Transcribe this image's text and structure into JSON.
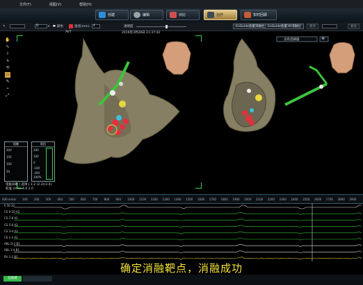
{
  "menu": [
    "文件(F)",
    "视图(V)",
    "帮助(H)"
  ],
  "modes": [
    {
      "label": "创建",
      "color": "#2f8fd8"
    },
    {
      "label": "编辑",
      "color": "#9aa2a8"
    },
    {
      "label": "对比",
      "color": "#d05050"
    },
    {
      "label": "治疗",
      "color": "#d8a850",
      "active": true
    },
    {
      "label": "实时回顾",
      "color": "#c65b34"
    }
  ],
  "toolbar": {
    "dropdown_value": "D",
    "pen_label": "颜色",
    "size_label": "直径(mm):",
    "size_value": "4",
    "opacity_label": "透明度",
    "btn1": "EnGuide放置消融灶",
    "btn2": "EnGuide放置3D消融灶",
    "btn3": "适合",
    "reset": "复位"
  },
  "subheader": {
    "left": "AVT",
    "center": "2016年3月28日 21:37:42"
  },
  "view_right_dropdown": "没有选择器",
  "palette": [
    "✋",
    "⇖",
    "I",
    "↳",
    "⟲",
    "▭",
    "✎",
    "⌁",
    "⤢"
  ],
  "gauges": [
    {
      "title": "接触",
      "ticks": [
        "200",
        "150",
        "100",
        "50"
      ]
    },
    {
      "title": "阻抗",
      "ticks": [
        "200",
        "100",
        "0",
        "-100",
        "-200",
        "100%"
      ]
    }
  ],
  "readout": {
    "line1": "电极间距 | 选项 | 1-2 (2-3)(3-4)",
    "line2": "标准 (mm)  4.0   2.0"
  },
  "ruler": {
    "prefix": "400 mm/s",
    "ticks": [
      "100",
      "200",
      "300",
      "400",
      "500",
      "600",
      "700",
      "800",
      "900",
      "1000",
      "1100",
      "1200",
      "1300",
      "1400",
      "1500",
      "1600",
      "1700",
      "1800",
      "1900",
      "2000",
      "2100",
      "2200",
      "2300",
      "2400",
      "2500",
      "2600",
      "2700",
      "2800",
      "2900"
    ]
  },
  "channels": [
    "II 50.32",
    "CS 9-10 A2",
    "CS 7-8 A2",
    "CS 5-6 A2",
    "CS 3-4 A2",
    "CS 1-2 A2",
    "ABL D-2 B1",
    "ABL 3-4 B1",
    "RV 1-2 B1"
  ],
  "subtitle": "确定消融靶点，消融成功",
  "status": {
    "ok_label": "已就绪"
  },
  "colors": {
    "accent": "#d8a850",
    "tissue": "#8a8266",
    "catheter": "#39c53a",
    "lesion": "#e33a45",
    "subtitle": "#f3e33c"
  }
}
